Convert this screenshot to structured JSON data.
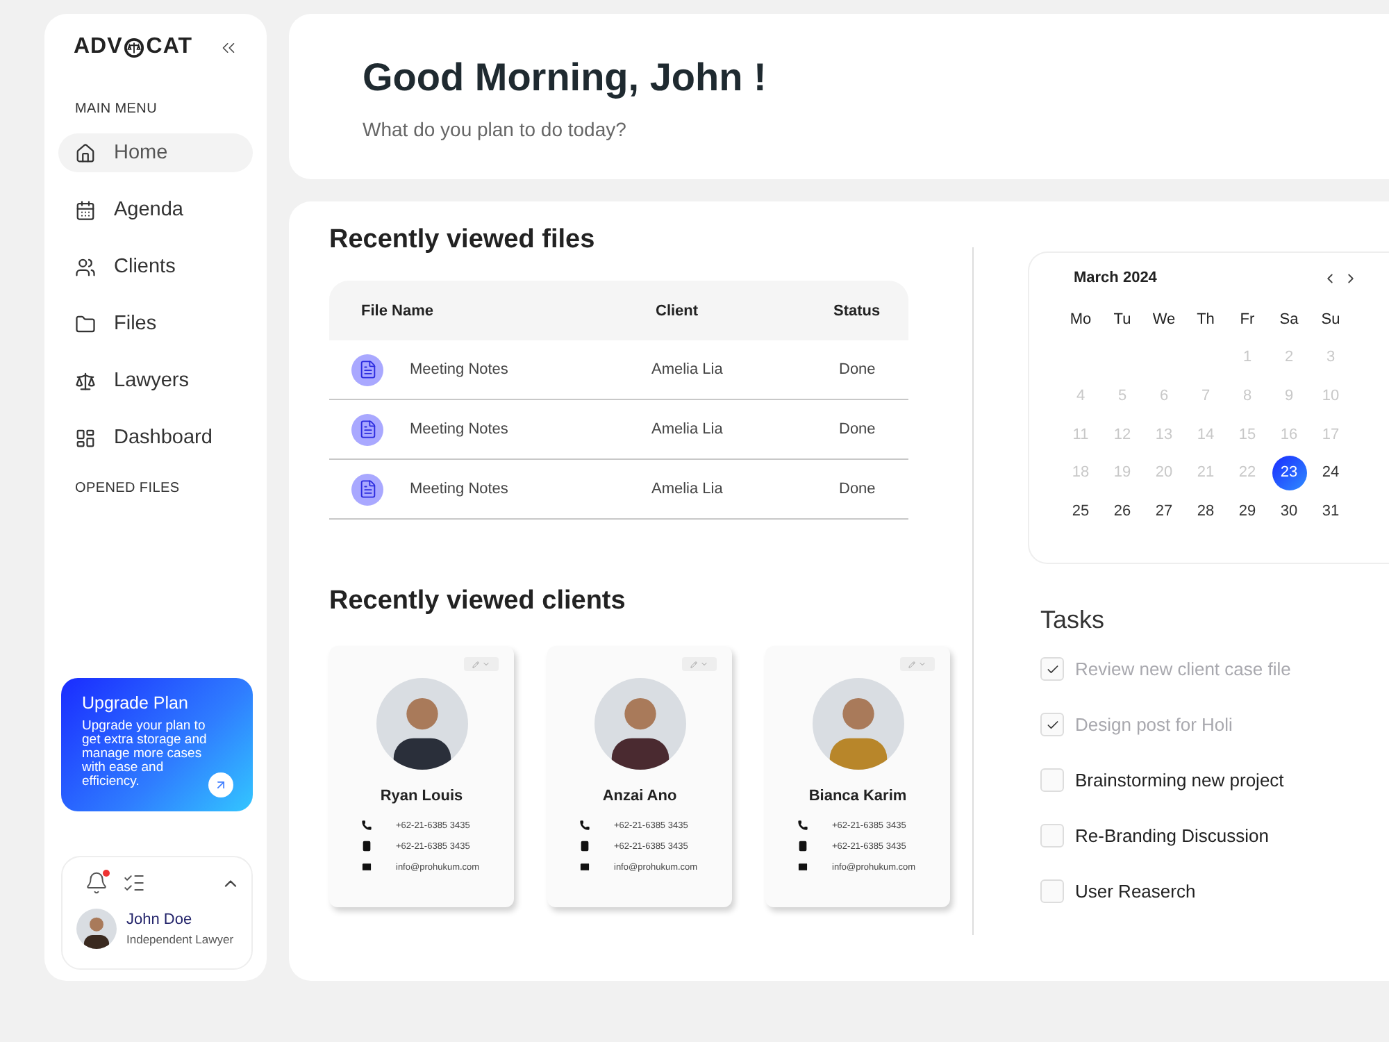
{
  "sidebar": {
    "logo_parts": [
      "ADV",
      "CAT"
    ],
    "main_menu_title": "MAIN MENU",
    "items": [
      {
        "label": "Home",
        "selected": true
      },
      {
        "label": "Agenda",
        "selected": false
      },
      {
        "label": "Clients",
        "selected": false
      },
      {
        "label": "Files",
        "selected": false
      },
      {
        "label": "Lawyers",
        "selected": false
      },
      {
        "label": "Dashboard",
        "selected": false
      }
    ],
    "opened_files_title": "OPENED FILES",
    "upgrade": {
      "title": "Upgrade Plan",
      "text": "Upgrade your plan to get extra storage and manage more cases with ease and efficiency."
    },
    "user": {
      "name": "John Doe",
      "role": "Independent Lawyer",
      "notification": true
    }
  },
  "header": {
    "greeting": "Good Morning, John !",
    "subtitle": "What do you plan to do today?"
  },
  "recent_files": {
    "title": "Recently viewed files",
    "columns": [
      "File Name",
      "Client",
      "Status"
    ],
    "rows": [
      {
        "name": "Meeting Notes",
        "client": "Amelia Lia",
        "status": "Done"
      },
      {
        "name": "Meeting Notes",
        "client": "Amelia Lia",
        "status": "Done"
      },
      {
        "name": "Meeting Notes",
        "client": "Amelia Lia",
        "status": "Done"
      }
    ]
  },
  "recent_clients": {
    "title": "Recently viewed clients",
    "clients": [
      {
        "name": "Ryan Louis",
        "phone": "+62-21-6385 3435",
        "mobile": "+62-21-6385 3435",
        "email": "info@prohukum.com",
        "color": "#2a2f3a"
      },
      {
        "name": "Anzai Ano",
        "phone": "+62-21-6385 3435",
        "mobile": "+62-21-6385 3435",
        "email": "info@prohukum.com",
        "color": "#4a2a30"
      },
      {
        "name": "Bianca Karim",
        "phone": "+62-21-6385 3435",
        "mobile": "+62-21-6385 3435",
        "email": "info@prohukum.com",
        "color": "#b8862a"
      }
    ]
  },
  "calendar": {
    "month": "March 2024",
    "weekdays": [
      "Mo",
      "Tu",
      "We",
      "Th",
      "Fr",
      "Sa",
      "Su"
    ],
    "days": [
      {
        "label": "1",
        "past": true,
        "selected": false
      },
      {
        "label": "2",
        "past": true,
        "selected": false
      },
      {
        "label": "3",
        "past": true,
        "selected": false
      },
      {
        "label": "4",
        "past": true,
        "selected": false
      },
      {
        "label": "5",
        "past": true,
        "selected": false
      },
      {
        "label": "6",
        "past": true,
        "selected": false
      },
      {
        "label": "7",
        "past": true,
        "selected": false
      },
      {
        "label": "8",
        "past": true,
        "selected": false
      },
      {
        "label": "9",
        "past": true,
        "selected": false
      },
      {
        "label": "10",
        "past": true,
        "selected": false
      },
      {
        "label": "11",
        "past": true,
        "selected": false
      },
      {
        "label": "12",
        "past": true,
        "selected": false
      },
      {
        "label": "13",
        "past": true,
        "selected": false
      },
      {
        "label": "14",
        "past": true,
        "selected": false
      },
      {
        "label": "15",
        "past": true,
        "selected": false
      },
      {
        "label": "16",
        "past": true,
        "selected": false
      },
      {
        "label": "17",
        "past": true,
        "selected": false
      },
      {
        "label": "18",
        "past": true,
        "selected": false
      },
      {
        "label": "19",
        "past": true,
        "selected": false
      },
      {
        "label": "20",
        "past": true,
        "selected": false
      },
      {
        "label": "21",
        "past": true,
        "selected": false
      },
      {
        "label": "22",
        "past": true,
        "selected": false
      },
      {
        "label": "23",
        "past": false,
        "selected": true
      },
      {
        "label": "24",
        "past": false,
        "selected": false
      },
      {
        "label": "25",
        "past": false,
        "selected": false
      },
      {
        "label": "26",
        "past": false,
        "selected": false
      },
      {
        "label": "27",
        "past": false,
        "selected": false
      },
      {
        "label": "28",
        "past": false,
        "selected": false
      },
      {
        "label": "29",
        "past": false,
        "selected": false
      },
      {
        "label": "30",
        "past": false,
        "selected": false
      },
      {
        "label": "31",
        "past": false,
        "selected": false
      }
    ]
  },
  "tasks": {
    "title": "Tasks",
    "items": [
      {
        "label": "Review new client case file",
        "checked": true
      },
      {
        "label": "Design post for Holi",
        "checked": true
      },
      {
        "label": "Brainstorming new project",
        "checked": false
      },
      {
        "label": "Re-Branding Discussion",
        "checked": false
      },
      {
        "label": "User Reaserch",
        "checked": false
      }
    ]
  }
}
